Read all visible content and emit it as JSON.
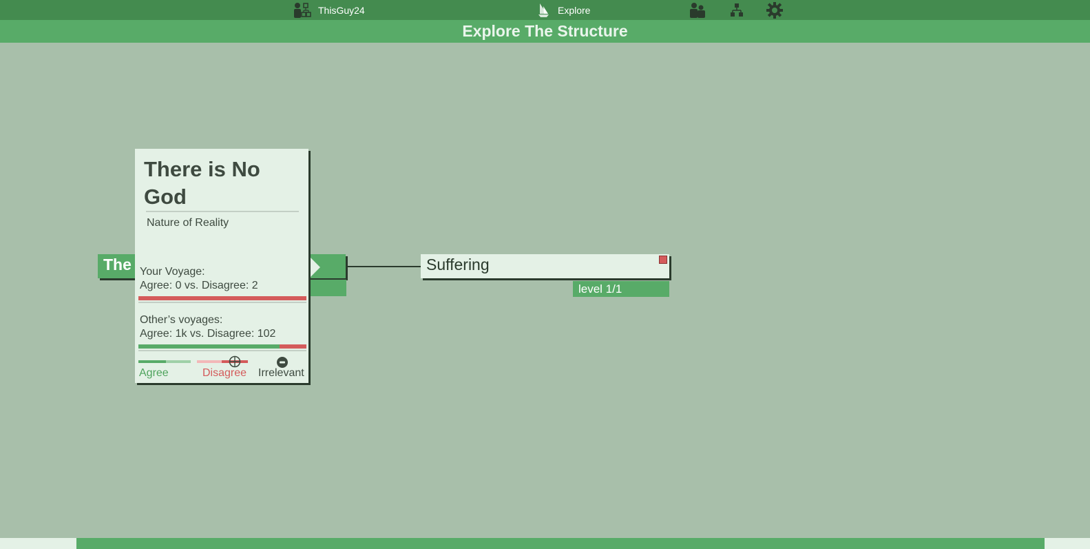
{
  "topbar": {
    "user_name": "ThisGuy24",
    "nav_explore": "Explore"
  },
  "page": {
    "title": "Explore The Structure"
  },
  "graph": {
    "left_node": {
      "title_visible": "The"
    },
    "suffering_node": {
      "title": "Suffering",
      "level": "level 1/1"
    }
  },
  "popup": {
    "title": "There is No God",
    "category": "Nature of Reality",
    "your_voyage": {
      "heading": "Your Voyage:",
      "summary": "Agree: 0 vs. Disagree: 2",
      "agree_fraction": 0.0
    },
    "others_voyage": {
      "heading": "Other’s voyages:",
      "summary": "Agree: 1k vs. Disagree: 102",
      "agree_fraction": 0.84
    },
    "buttons": {
      "agree": "Agree",
      "disagree": "Disagree",
      "irrelevant": "Irrelevant"
    }
  },
  "colors": {
    "topbar": "#448b4f",
    "accent_green": "#58ab68",
    "background": "#a8bfaa",
    "card": "#e4f1e6",
    "disagree_red": "#d45b5b"
  }
}
